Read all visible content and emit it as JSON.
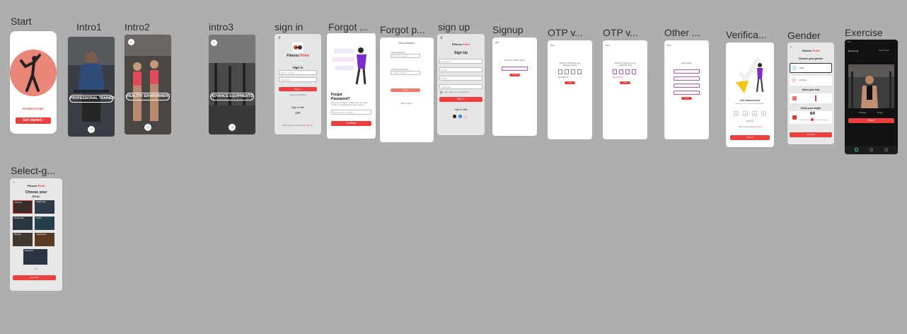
{
  "frames": {
    "start": {
      "label": "Start",
      "brand": "FITNESS POINT",
      "cta": "Get started",
      "cta_arrow": "›"
    },
    "intro1": {
      "label": "Intro1",
      "caption": "PROFESSIONAL TRAINER",
      "next": "→"
    },
    "intro2": {
      "label": "Intro2",
      "caption": "HEALTHY ENVIRONMENT",
      "next": "→",
      "back": "←"
    },
    "intro3": {
      "label": "intro3",
      "caption": "ADVANCE EQUIPMENTS",
      "next": "→",
      "back": "←"
    },
    "signin": {
      "label": "sign in",
      "menu": "≡",
      "brand_a": "Fitness ",
      "brand_b": "Point",
      "title": "Sign in",
      "phone_ph": "Phone / Email",
      "pass_ph": "Password",
      "button": "Sign in",
      "forgot": "Forgot password?",
      "with": "Sign in with",
      "otp": "OTP",
      "footer_a": "Don't have an account? ",
      "footer_b": "Sign up"
    },
    "forgot1": {
      "label": "Forgot ...",
      "heading_l1": "Forgot",
      "heading_l2": "Password?",
      "body": "Don't worry it happens. Please enter the phone number or email linked with your account.",
      "input_ph": "Enter email or phone",
      "button": "Continue"
    },
    "forgot2": {
      "label": "Forgot p...",
      "title": "New password",
      "f1": "New password",
      "f1_ph": "Enter new password",
      "f2": "Confirm password",
      "f2_ph": "Confirm password",
      "button": "Save",
      "link": "Back to sign in"
    },
    "signup": {
      "label": "sign up",
      "menu": "≡",
      "brand_a": "Fitness ",
      "brand_b": "Point",
      "title": "Sign Up",
      "f1": "Full name",
      "f2": "Email",
      "f3": "Phone",
      "f4": "Password",
      "agree": "I agree with terms and conditions",
      "button": "Sign in",
      "with": "Sign in with",
      "social": [
        "",
        "f",
        "G"
      ]
    },
    "signup2": {
      "label": "Signup",
      "back": "Back",
      "line": "Enter your mobile number",
      "button": "Send OTP"
    },
    "otp1": {
      "label": "OTP v...",
      "back": "Back",
      "line1": "Enter the OTP sent to your",
      "line2": "registered number",
      "resend": "Resend OTP",
      "button": "Verify"
    },
    "otp2": {
      "label": "OTP v...",
      "back": "Back",
      "line1": "Enter the OTP sent to your",
      "line2": "registered email",
      "resend": "Resend OTP",
      "button": "Verify"
    },
    "other": {
      "label": "Other ...",
      "back": "Back",
      "title": "Other details",
      "button": "Next"
    },
    "verification": {
      "label": "Verifica...",
      "title": "OTP VERIFICATION",
      "sub": "Enter the OTP sent to +91 XXXXXXXXXX",
      "digits": [
        "3",
        "4",
        "2",
        "8"
      ],
      "timer": "00:30 sec",
      "resend_a": "Don't receive code? ",
      "resend_b": "Re-send",
      "button": "Submit"
    },
    "gender": {
      "label": "Gender",
      "back": "←",
      "brand_a": "Fitness ",
      "brand_b": "Point",
      "q": "Choose your gender",
      "male": "Male",
      "female": "Female",
      "year_q": "Select your Year",
      "weight_q": "Select your weight",
      "weight": "64",
      "button": "Continue"
    },
    "exercise": {
      "label": "Exercise",
      "time": "9:41",
      "title": "Bench pull",
      "right": "Guest Trainer",
      "stat1": "12 Reps",
      "stat2": "10 kg",
      "button": "START"
    },
    "goal": {
      "label": "Select-g...",
      "back": "←",
      "brand_a": "Fitness ",
      "brand_b": "Point",
      "title_l1": "Choose your",
      "title_l2": "GOAL",
      "tiles": [
        "Fat Loss",
        "Weight Gain",
        "Muscle Gain",
        "Cardio",
        "Strength",
        "Yoga Fitness",
        "Endurance"
      ],
      "skip": "Skip",
      "button": "Continue"
    }
  },
  "colors": {
    "canvas": "#aeaeae",
    "accent": "#ee3f3f",
    "salmon": "#ea8677",
    "purple": "#7b2ccb"
  },
  "icons": [
    "menu-icon",
    "back-arrow-icon",
    "next-arrow-icon",
    "apple-icon",
    "facebook-icon",
    "google-icon",
    "home-icon",
    "settings-icon"
  ]
}
